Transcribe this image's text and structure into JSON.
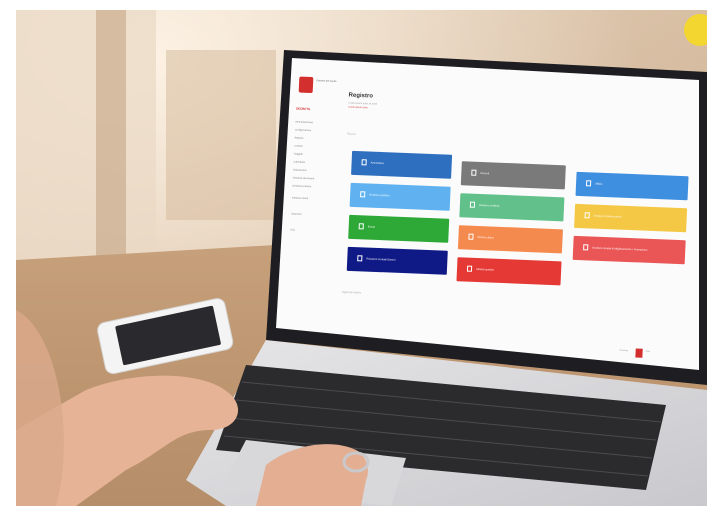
{
  "app": {
    "brand": "SECRETS",
    "logo_text": "Distretto del Sanità",
    "page_title": "Registro",
    "page_subtitle": "Lorem ipsum dolor sit amet",
    "page_subtitle2": "Lorem ipsum dolor",
    "search_placeholder": "Ricerca",
    "address_placeholder": "Aggiungi registro",
    "pagination": {
      "prev": "Previous",
      "next": "Next"
    }
  },
  "sidebar": {
    "items": [
      "Amministrazione",
      "Configurazione",
      "Registro",
      "Contatti",
      "Soggetti",
      "Calendario",
      "Impostazioni",
      "Gestione documenti",
      "Gestione pratiche",
      "Gestione utenti",
      "Strumenti",
      "Esci"
    ]
  },
  "tiles": [
    {
      "label": "Archivistica",
      "color": "#2f6fbf"
    },
    {
      "label": "Docenti",
      "color": "#7a7a7a"
    },
    {
      "label": "Ufficio",
      "color": "#3f8fe0"
    },
    {
      "label": "Gestione pratiche",
      "color": "#5fb2ef"
    },
    {
      "label": "Gestione verifiche",
      "color": "#62c08a"
    },
    {
      "label": "Gestione reclami esterni",
      "color": "#f4c845"
    },
    {
      "label": "Eventi",
      "color": "#2ea836"
    },
    {
      "label": "Rischio clinico",
      "color": "#f58a4f"
    },
    {
      "label": "Gestione Gruppi di Miglioramento e Formazione",
      "color": "#ea5656"
    },
    {
      "label": "Relazioni Contatti Esterni",
      "color": "#0f1a86"
    },
    {
      "label": "Attività ispettive",
      "color": "#e53935"
    }
  ],
  "colors": {
    "accent": "#d32f2f"
  }
}
